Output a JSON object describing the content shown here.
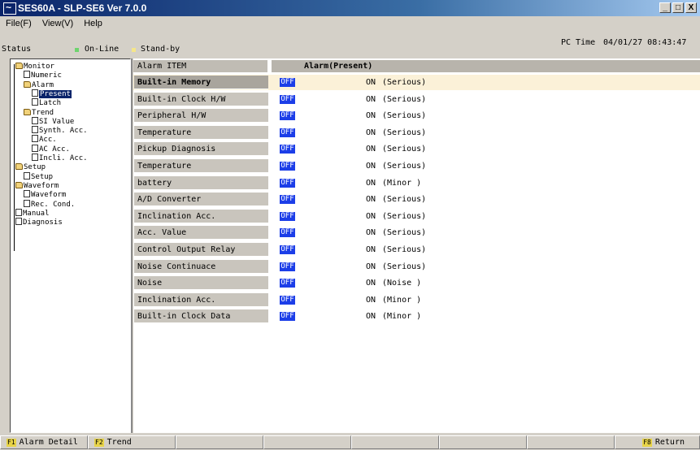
{
  "window": {
    "title": "SES60A - SLP-SE6 Ver 7.0.0",
    "buttons": [
      "_",
      "□",
      "X"
    ]
  },
  "menu": [
    "File(F)",
    "View(V)",
    "Help"
  ],
  "status": {
    "label": "Status",
    "online": "On-Line",
    "standby": "Stand-by",
    "pc_time_label": "PC Time",
    "pc_time_value": "04/01/27 08:43:47"
  },
  "tree": [
    {
      "label": "Monitor",
      "icon": "folder"
    },
    {
      "label": "Numeric",
      "icon": "doc"
    },
    {
      "label": "Alarm",
      "icon": "folder"
    },
    {
      "label": "Present",
      "icon": "doc",
      "selected": true
    },
    {
      "label": "Latch",
      "icon": "doc"
    },
    {
      "label": "Trend",
      "icon": "folder"
    },
    {
      "label": "SI Value",
      "icon": "doc"
    },
    {
      "label": "Synth. Acc.",
      "icon": "doc"
    },
    {
      "label": "Acc.",
      "icon": "doc"
    },
    {
      "label": "AC Acc.",
      "icon": "doc"
    },
    {
      "label": "Incli. Acc.",
      "icon": "doc"
    },
    {
      "label": "Setup",
      "icon": "folder"
    },
    {
      "label": "Setup",
      "icon": "doc"
    },
    {
      "label": "Waveform",
      "icon": "folder"
    },
    {
      "label": "Waveform",
      "icon": "doc"
    },
    {
      "label": "Rec. Cond.",
      "icon": "doc"
    },
    {
      "label": "Manual",
      "icon": "doc"
    },
    {
      "label": "Diagnosis",
      "icon": "doc"
    }
  ],
  "table": {
    "header_item": "Alarm ITEM",
    "header_alarm": "Alarm(Present)",
    "rows": [
      {
        "item": "Built-in Memory",
        "state": "OFF",
        "on": "ON",
        "severity": "(Serious)",
        "highlight": true
      },
      {
        "item": "Built-in Clock H/W",
        "state": "OFF",
        "on": "ON",
        "severity": "(Serious)"
      },
      {
        "item": "Peripheral H/W",
        "state": "OFF",
        "on": "ON",
        "severity": "(Serious)"
      },
      {
        "item": "Temperature",
        "state": "OFF",
        "on": "ON",
        "severity": "(Serious)"
      },
      {
        "item": "Pickup Diagnosis",
        "state": "OFF",
        "on": "ON",
        "severity": "(Serious)"
      },
      {
        "item": "Temperature",
        "state": "OFF",
        "on": "ON",
        "severity": "(Serious)"
      },
      {
        "item": "battery",
        "state": "OFF",
        "on": "ON",
        "severity": "(Minor )"
      },
      {
        "item": "A/D Converter",
        "state": "OFF",
        "on": "ON",
        "severity": "(Serious)"
      },
      {
        "item": "Inclination Acc.",
        "state": "OFF",
        "on": "ON",
        "severity": "(Serious)"
      },
      {
        "item": "Acc. Value",
        "state": "OFF",
        "on": "ON",
        "severity": "(Serious)"
      },
      {
        "item": "Control Output Relay",
        "state": "OFF",
        "on": "ON",
        "severity": "(Serious)"
      },
      {
        "item": "Noise Continuace",
        "state": "OFF",
        "on": "ON",
        "severity": "(Serious)"
      },
      {
        "item": "Noise",
        "state": "OFF",
        "on": "ON",
        "severity": "(Noise )"
      },
      {
        "item": "Inclination Acc.",
        "state": "OFF",
        "on": "ON",
        "severity": "(Minor )"
      },
      {
        "item": "Built-in Clock Data",
        "state": "OFF",
        "on": "ON",
        "severity": "(Minor )"
      }
    ]
  },
  "footer": [
    {
      "key": "F1",
      "label": "Alarm Detail"
    },
    {
      "key": "F2",
      "label": "Trend"
    },
    {
      "key": "",
      "label": ""
    },
    {
      "key": "",
      "label": ""
    },
    {
      "key": "",
      "label": ""
    },
    {
      "key": "",
      "label": ""
    },
    {
      "key": "",
      "label": ""
    },
    {
      "key": "F8",
      "label": "Return"
    }
  ]
}
